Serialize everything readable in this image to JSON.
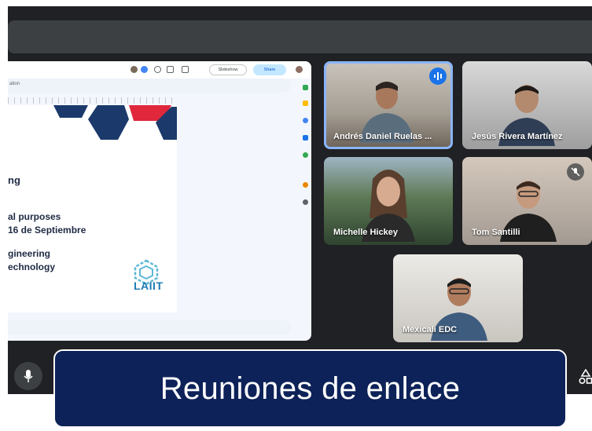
{
  "presentation": {
    "toolbar": {
      "slideshow_label": "Slideshow",
      "share_label": "Share"
    },
    "menu_text": "ation",
    "slide": {
      "lines": [
        {
          "key": "l1",
          "text": "ng"
        },
        {
          "key": "l2",
          "text": "al purposes"
        },
        {
          "key": "l3",
          "text": "16 de Septiembre"
        },
        {
          "key": "l4",
          "text": "gineering"
        },
        {
          "key": "l5",
          "text": "echnology"
        }
      ],
      "logo_text": "LAIIT"
    }
  },
  "participants": [
    {
      "name": "Andrés Daniel Ruelas ...",
      "speaking": true
    },
    {
      "name": "Jesús Rivera Martínez",
      "speaking": false
    },
    {
      "name": "Michelle Hickey",
      "speaking": false
    },
    {
      "name": "Tom Santilli",
      "muted": true
    },
    {
      "name": "Mexicali EDC",
      "speaking": false
    }
  ],
  "caption": "Reuniones de enlace",
  "colors": {
    "meet_bg": "#202124",
    "caption_bg": "#0d2258",
    "speaking_outline": "#8ab4f8",
    "slide_navy": "#1b3a6b",
    "slide_red": "#e0273b"
  }
}
